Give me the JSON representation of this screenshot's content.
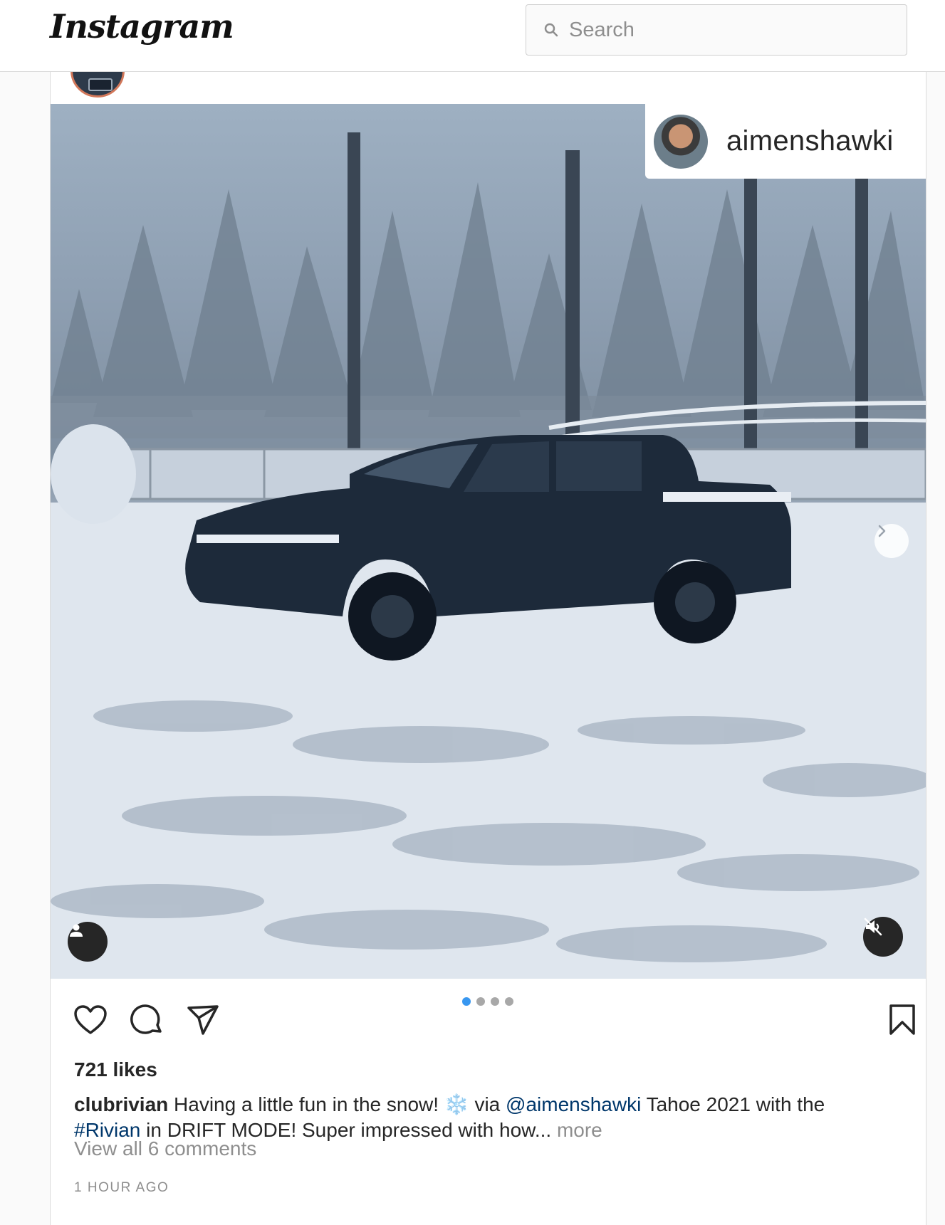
{
  "header": {
    "logo_text": "Instagram",
    "search_placeholder": "Search"
  },
  "post": {
    "tagged_user": "aimenshawki",
    "carousel": {
      "count": 4,
      "active_index": 0
    },
    "likes": "721 likes",
    "caption": {
      "username": "clubrivian",
      "text_1": " Having a little fun in the snow! ❄️ via ",
      "mention": "@aimenshawki",
      "text_2": " Tahoe 2021 with the ",
      "hashtag": "#Rivian",
      "text_3": " in DRIFT MODE! Super impressed with how... ",
      "more": "more"
    },
    "view_comments": "View all 6 comments",
    "timestamp": "1 HOUR AGO"
  },
  "icons": {
    "search": "search-icon",
    "like": "heart-icon",
    "comment": "comment-icon",
    "share": "send-icon",
    "save": "bookmark-icon",
    "next": "chevron-right-icon",
    "user_tag": "person-icon",
    "mute": "muted-speaker-icon"
  },
  "colors": {
    "accent": "#3897f0",
    "link": "#00376b",
    "muted": "#8e8e8e",
    "avatar_ring": "#d2785a"
  }
}
